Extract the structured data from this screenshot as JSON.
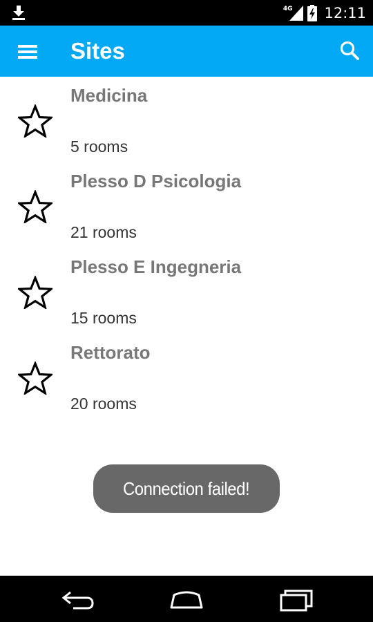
{
  "status_bar": {
    "network_label": "4G",
    "time": "12:11",
    "icons": [
      "download-icon",
      "signal-icon",
      "battery-charging-icon"
    ]
  },
  "app_bar": {
    "title": "Sites",
    "menu_icon": "hamburger-menu-icon",
    "search_icon": "search-icon",
    "color": "#03a9f4"
  },
  "sites": [
    {
      "name": "Medicina",
      "rooms": "5 rooms",
      "icon": "star-outline-icon"
    },
    {
      "name": "Plesso D Psicologia",
      "rooms": "21 rooms",
      "icon": "star-outline-icon"
    },
    {
      "name": "Plesso E Ingegneria",
      "rooms": "15 rooms",
      "icon": "star-outline-icon"
    },
    {
      "name": "Rettorato",
      "rooms": "20 rooms",
      "icon": "star-outline-icon"
    }
  ],
  "toast": {
    "message": "Connection failed!"
  },
  "nav_bar": {
    "icons": [
      "back-icon",
      "home-icon",
      "recent-apps-icon"
    ]
  }
}
